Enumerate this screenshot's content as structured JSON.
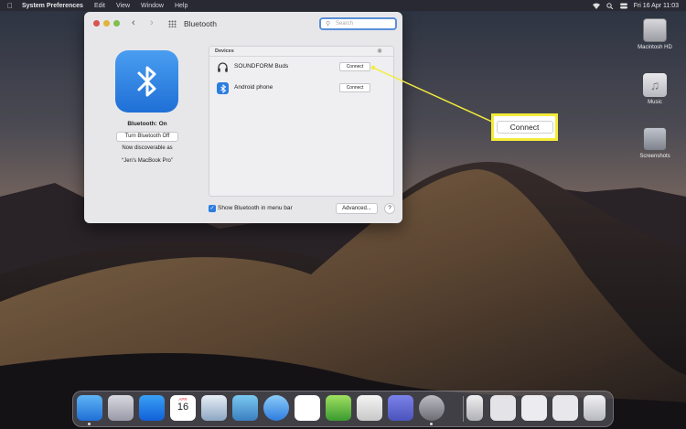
{
  "menubar": {
    "app": "System Preferences",
    "items": [
      "Edit",
      "View",
      "Window",
      "Help"
    ],
    "datetime": "Fri 16 Apr  11:03"
  },
  "desktop_icons": [
    {
      "label": "Macintosh HD"
    },
    {
      "label": "Music"
    },
    {
      "label": "Screenshots"
    }
  ],
  "window": {
    "title": "Bluetooth",
    "search_placeholder": "Search"
  },
  "bluetooth": {
    "status": "Bluetooth: On",
    "toggle_label": "Turn Bluetooth Off",
    "discoverable_text": "Now discoverable as",
    "device_name": "“Jen’s MacBook Pro”"
  },
  "devices": {
    "header": "Devices",
    "items": [
      {
        "name": "SOUNDFORM Buds",
        "icon": "headphones-icon",
        "button": "Connect"
      },
      {
        "name": "Android phone",
        "icon": "bluetooth-icon",
        "button": "Connect"
      }
    ]
  },
  "footer": {
    "show_in_menu_bar_label": "Show Bluetooth in menu bar",
    "show_in_menu_bar_checked": true,
    "advanced_label": "Advanced...",
    "help_label": "?"
  },
  "callout": {
    "label": "Connect",
    "highlight_color": "#f3ec3a"
  },
  "dock": {
    "calendar_month": "APR",
    "calendar_day": "16"
  },
  "colors": {
    "accent": "#2b7de0"
  }
}
